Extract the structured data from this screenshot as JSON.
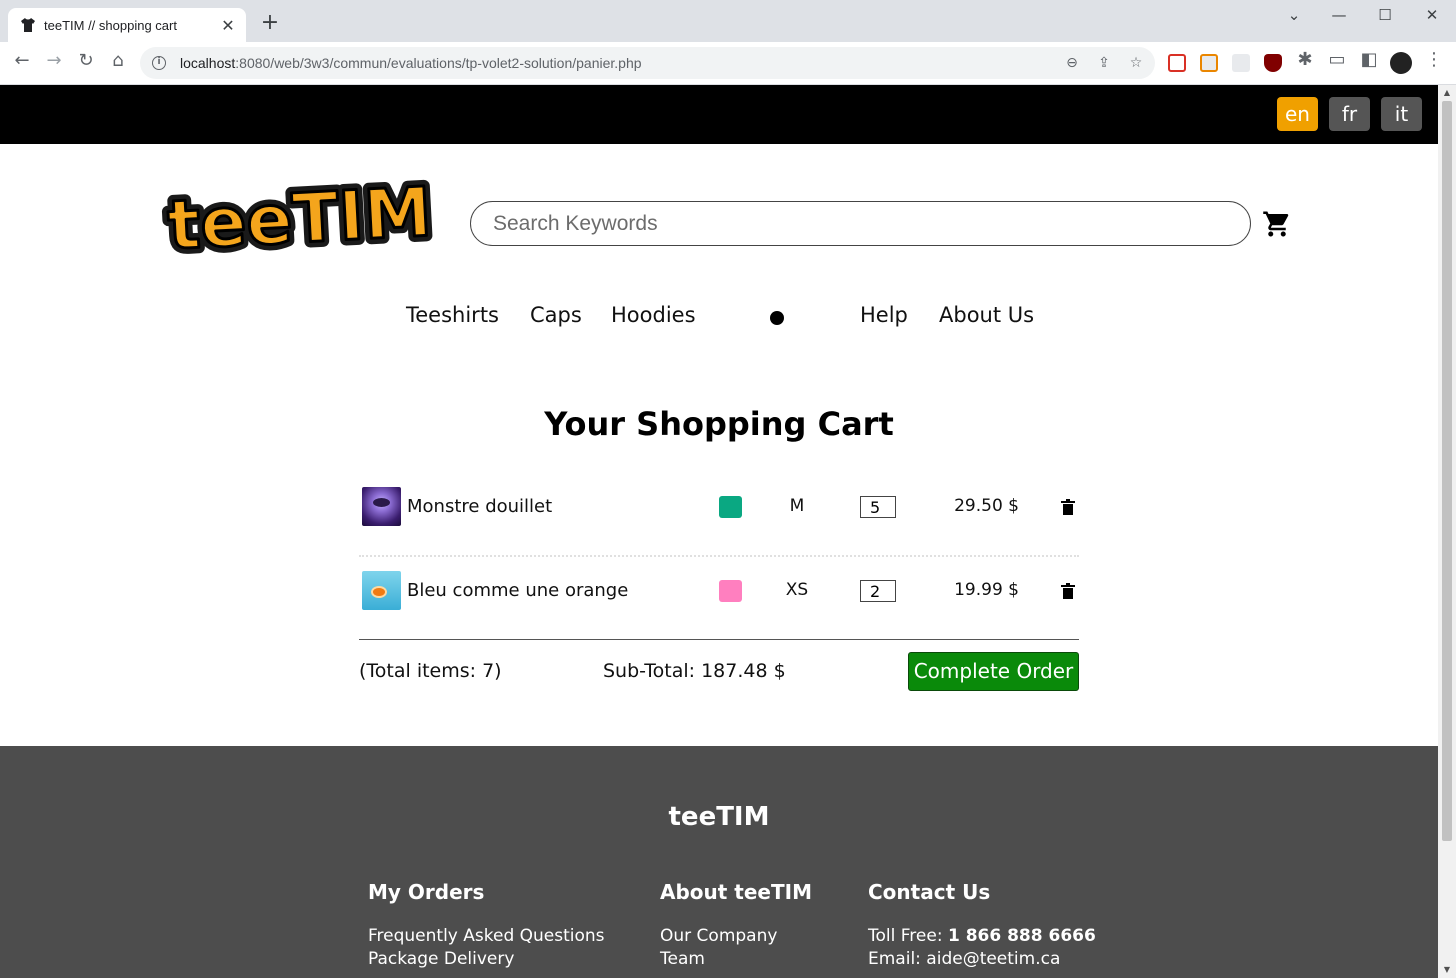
{
  "browser": {
    "tab_title": "teeTIM // shopping cart",
    "url_host": "localhost",
    "url_rest": ":8080/web/3w3/commun/evaluations/tp-volet2-solution/panier.php"
  },
  "languages": [
    {
      "code": "en",
      "active": true,
      "color": "#f0a000"
    },
    {
      "code": "fr",
      "active": false,
      "color": "#555555"
    },
    {
      "code": "it",
      "active": false,
      "color": "#555555"
    }
  ],
  "header": {
    "logo_text": "teeTIM",
    "search_placeholder": "Search Keywords"
  },
  "nav": {
    "teeshirts": "Teeshirts",
    "caps": "Caps",
    "hoodies": "Hoodies",
    "help": "Help",
    "about": "About Us"
  },
  "cart": {
    "title": "Your Shopping Cart",
    "items": [
      {
        "name": "Monstre douillet",
        "color": "#0aa882",
        "size": "M",
        "quantity": "5",
        "price": "29.50 $"
      },
      {
        "name": "Bleu comme une orange",
        "color": "#ff7fbf",
        "size": "XS",
        "quantity": "2",
        "price": "19.99 $"
      }
    ],
    "total_items": "(Total items: 7)",
    "subtotal": "Sub-Total: 187.48 $",
    "complete_label": "Complete Order"
  },
  "footer": {
    "brand": "teeTIM",
    "col1_title": "My Orders",
    "col1_links": [
      "Frequently Asked Questions",
      "Package Delivery"
    ],
    "col2_title": "About teeTIM",
    "col2_links": [
      "Our Company",
      "Team"
    ],
    "col3_title": "Contact Us",
    "tollfree_label": "Toll Free: ",
    "tollfree_value": "1 866 888 6666",
    "email_label": "Email: ",
    "email_value": "aide@teetim.ca"
  }
}
